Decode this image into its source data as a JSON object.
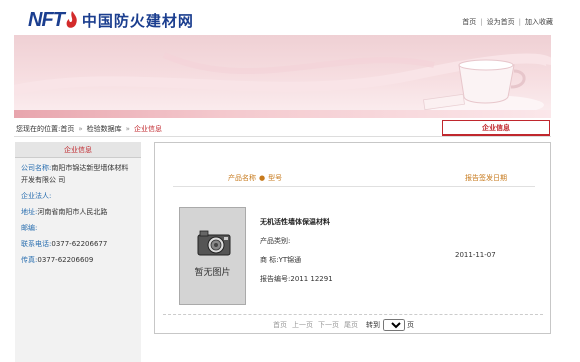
{
  "header": {
    "logo_text": "NFT",
    "logo_cn": "中国防火建材网",
    "links": [
      "首页",
      "设为首页",
      "加入收藏"
    ]
  },
  "breadcrumb": {
    "prefix": "您现在的位置:首页",
    "arrow": "»",
    "mid": "检验数据库",
    "current": "企业信息"
  },
  "tab_label": "企业信息",
  "sidebar": {
    "title": "企业信息",
    "company_label": "公司名称:",
    "company_value": "南阳市锦达新型墙体材料开发有限公 司",
    "contact_label": "企业法人:",
    "contact_value": "",
    "address_label": "地址:",
    "address_value": "河南省南阳市人民北路",
    "email_label": "邮编:",
    "email_value": "",
    "phone_label": "联系电话:",
    "phone_value": "0377-62206677",
    "fax_label": "传真:",
    "fax_value": "0377-62206609"
  },
  "table": {
    "col_product": "产品名称",
    "col_star": "●",
    "col_model": "型号",
    "col_date": "报告签发日期"
  },
  "product": {
    "no_image": "暂无图片",
    "name": "无机活性墙体保温材料",
    "category_label": "产品类别:",
    "category_value": "",
    "brand_label": "商 标:",
    "brand_value": "YT锦通",
    "report_label": "报告编号:",
    "report_value": "2011 12291",
    "date": "2011-11-07"
  },
  "pager": {
    "first": "首页",
    "prev": "上一页",
    "next": "下一页",
    "last": "尾页",
    "goto": "转到",
    "selected": "1",
    "page_suffix": "页"
  },
  "colors": {
    "brand_blue": "#1b3e8f",
    "accent_red": "#c0272d",
    "header_orange": "#c77a1d"
  }
}
